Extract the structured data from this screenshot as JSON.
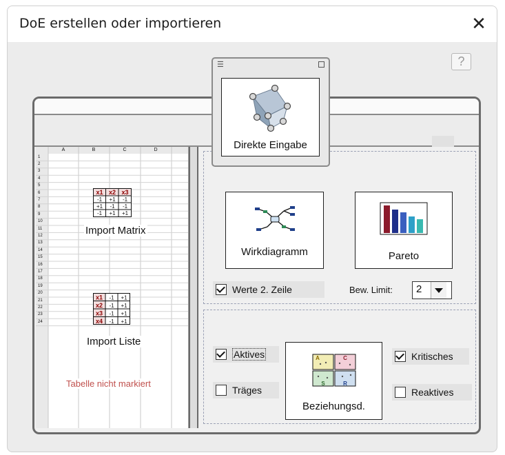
{
  "window": {
    "title": "DoE erstellen oder importieren",
    "close_glyph": "✕",
    "help_glyph": "?"
  },
  "floating": {
    "title": "Direkte Eingabe",
    "icon": "cube-icon"
  },
  "spreadsheet": {
    "columns": [
      "A",
      "B",
      "C",
      "D"
    ],
    "rows": [
      "1",
      "2",
      "3",
      "4",
      "5",
      "6",
      "7",
      "8",
      "9",
      "10",
      "11",
      "12",
      "13",
      "14",
      "15",
      "16",
      "17",
      "18",
      "19",
      "20",
      "21",
      "22",
      "23",
      "24"
    ],
    "import_matrix_label": "Import Matrix",
    "import_list_label": "Import Liste",
    "status_text": "Tabelle nicht markiert",
    "matrix_icon": {
      "header": [
        "x1",
        "x2",
        "x3"
      ],
      "cells": [
        [
          "-1",
          "+1",
          "-1"
        ],
        [
          "+1",
          "-1",
          "-1"
        ],
        [
          "-1",
          "+1",
          "+1"
        ]
      ]
    },
    "list_icon": {
      "rows": [
        [
          "x1",
          "-1",
          "+1"
        ],
        [
          "x2",
          "-1",
          "+1"
        ],
        [
          "x3",
          "-1",
          "+1"
        ],
        [
          "x4",
          "-1",
          "+1"
        ]
      ]
    }
  },
  "top_section": {
    "wirkdiagramm_label": "Wirkdiagramm",
    "pareto_label": "Pareto",
    "werte_label": "Werte 2. Zeile",
    "werte_checked": true,
    "limit_label": "Bew. Limit:",
    "limit_value": "2"
  },
  "bottom_section": {
    "aktives_label": "Aktives",
    "aktives_checked": true,
    "traeges_label": "Träges",
    "traeges_checked": false,
    "kritisches_label": "Kritisches",
    "kritisches_checked": true,
    "reaktives_label": "Reaktives",
    "reaktives_checked": false,
    "beziehung_label": "Beziehungsd.",
    "quadrant_letters": [
      "A",
      "C",
      "S",
      "R"
    ]
  },
  "colors": {
    "pareto_bars": [
      "#8b1a2b",
      "#1f2f8a",
      "#3a5fbf",
      "#2ea0c8",
      "#39b9b0"
    ],
    "warning": "#c0504d"
  }
}
